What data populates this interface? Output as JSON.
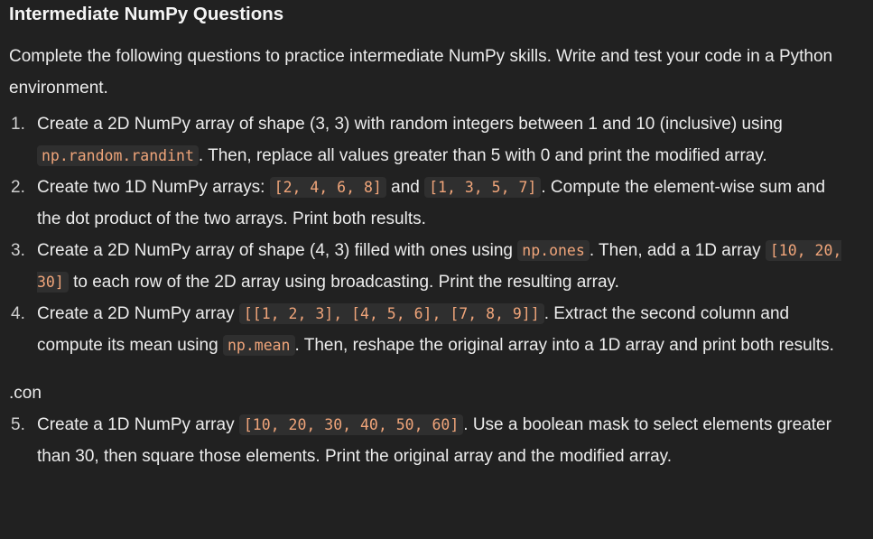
{
  "title": "Intermediate NumPy Questions",
  "intro": "Complete the following questions to practice intermediate NumPy skills. Write and test your code in a Python environment.",
  "questions": [
    {
      "num": "1.",
      "p1": "Create a 2D NumPy array of shape (3, 3) with random integers between 1 and 10 (inclusive) using ",
      "c1": "np.random.randint",
      "p2": ". Then, replace all values greater than 5 with 0 and print the modified array."
    },
    {
      "num": "2.",
      "p1": "Create two 1D NumPy arrays: ",
      "c1": "[2, 4, 6, 8]",
      "p2": " and ",
      "c2": "[1, 3, 5, 7]",
      "p3": ". Compute the element-wise sum and the dot product of the two arrays. Print both results."
    },
    {
      "num": "3.",
      "p1": "Create a 2D NumPy array of shape (4, 3) filled with ones using ",
      "c1": "np.ones",
      "p2": ". Then, add a 1D array ",
      "c2": "[10, 20, 30]",
      "p3": " to each row of the 2D array using broadcasting. Print the resulting array."
    },
    {
      "num": "4.",
      "p1": "Create a 2D NumPy array ",
      "c1": "[[1, 2, 3], [4, 5, 6], [7, 8, 9]]",
      "p2": ". Extract the second column and compute its mean using ",
      "c2": "np.mean",
      "p3": ". Then, reshape the original array into a 1D array and print both results."
    }
  ],
  "separator_text": ".con",
  "question5": {
    "num": "5.",
    "p1": "Create a 1D NumPy array ",
    "c1": "[10, 20, 30, 40, 50, 60]",
    "p2": ". Use a boolean mask to select elements greater than 30, then square those elements. Print the original array and the modified array."
  }
}
